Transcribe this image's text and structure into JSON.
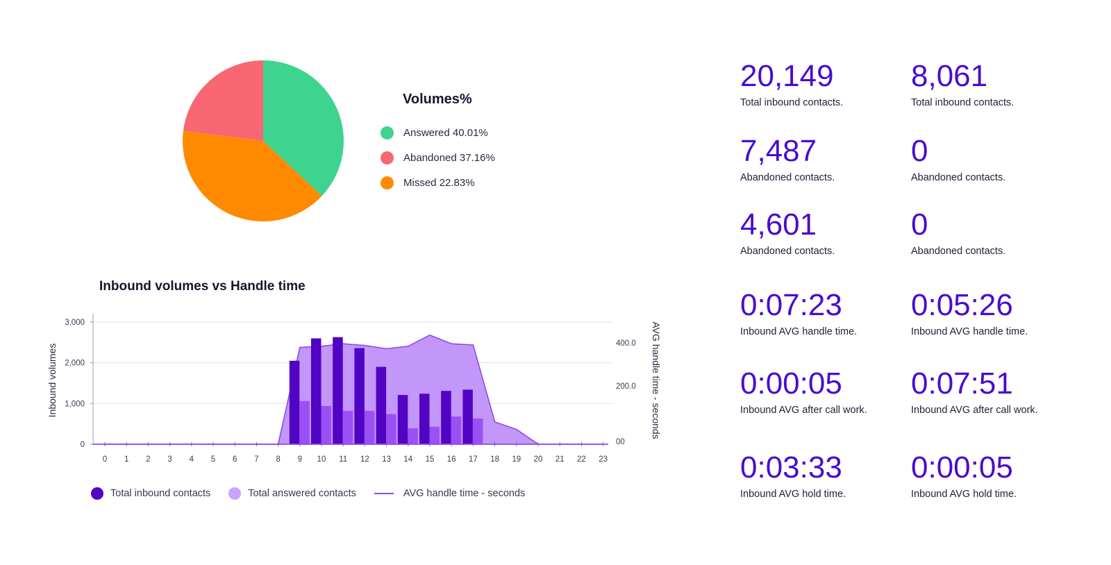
{
  "chart_data": [
    {
      "type": "pie",
      "title": "Volumes%",
      "legend_position": "right",
      "slices": [
        {
          "label": "Answered",
          "legend_text": "Answered 40.01%",
          "value": 40.01,
          "color": "#3ed38f"
        },
        {
          "label": "Abandoned",
          "legend_text": "Abandoned 37.16%",
          "value": 37.16,
          "color": "#f76672"
        },
        {
          "label": "Missed",
          "legend_text": "Missed 22.83%",
          "value": 22.83,
          "color": "#ff8a00"
        }
      ],
      "drawn_slices_clockwise_from_top": [
        {
          "label": "Answered",
          "value": 37.0,
          "color": "#3ed38f"
        },
        {
          "label": "Missed",
          "value": 40.0,
          "color": "#ff8a00"
        },
        {
          "label": "Abandoned",
          "value": 23.0,
          "color": "#f76672"
        }
      ]
    },
    {
      "type": "bar",
      "title": "Inbound volumes vs Handle time",
      "xlabel": "",
      "ylabel": "Inbound volumes",
      "y2label": "AVG handle time - seconds",
      "categories": [
        "0",
        "1",
        "2",
        "3",
        "4",
        "5",
        "6",
        "7",
        "8",
        "9",
        "10",
        "11",
        "12",
        "13",
        "14",
        "15",
        "16",
        "17",
        "18",
        "19",
        "20",
        "21",
        "22",
        "23"
      ],
      "ylim": [
        0,
        3000
      ],
      "yticks": [
        "0",
        "1,000",
        "2,000",
        "3,000"
      ],
      "ytick_values": [
        0,
        1000,
        2000,
        3000
      ],
      "y2lim": [
        0,
        850
      ],
      "y2ticks": [
        "00",
        "200.0",
        "400.0"
      ],
      "y2tick_values": [
        0,
        200,
        400
      ],
      "grid": true,
      "legend_position": "bottom-left",
      "series": [
        {
          "name": "Total inbound contacts",
          "kind": "bar",
          "axis": "left",
          "color": "#5204c4",
          "values": [
            0,
            0,
            0,
            0,
            0,
            0,
            0,
            0,
            0,
            2050,
            2600,
            2630,
            2360,
            1900,
            1210,
            1240,
            1310,
            1340,
            0,
            0,
            0,
            0,
            0,
            0
          ]
        },
        {
          "name": "Total answered contacts",
          "kind": "bar",
          "axis": "left",
          "color": "#9b50f5",
          "values": [
            0,
            0,
            0,
            0,
            0,
            0,
            0,
            0,
            0,
            1060,
            940,
            820,
            820,
            740,
            390,
            430,
            680,
            630,
            0,
            0,
            0,
            0,
            0,
            0
          ]
        },
        {
          "name": "AVG handle time - seconds",
          "kind": "area",
          "axis": "right",
          "color": "#8a4ce6",
          "fill": "#c396fa",
          "values": [
            0,
            0,
            0,
            0,
            0,
            0,
            0,
            0,
            0,
            390,
            395,
            405,
            398,
            385,
            395,
            440,
            405,
            400,
            90,
            60,
            0,
            0,
            0,
            0
          ]
        }
      ]
    }
  ],
  "pie": {
    "legend_title": "Volumes%",
    "items": [
      {
        "label": "Answered 40.01%",
        "color": "#3ed38f"
      },
      {
        "label": "Abandoned 37.16%",
        "color": "#f76672"
      },
      {
        "label": "Missed 22.83%",
        "color": "#ff8a00"
      }
    ]
  },
  "bar_chart": {
    "title": "Inbound volumes vs Handle time",
    "legend": [
      {
        "label": "Total inbound contacts",
        "color": "#5204c4",
        "shape": "dot"
      },
      {
        "label": "Total answered contacts",
        "color": "#c9a4fb",
        "shape": "dot"
      },
      {
        "label": "AVG handle time - seconds",
        "color": "#8a4ce6",
        "shape": "line"
      }
    ]
  },
  "stats": [
    {
      "value": "20,149",
      "label": "Total inbound contacts."
    },
    {
      "value": "8,061",
      "label": "Total inbound contacts."
    },
    {
      "value": "7,487",
      "label": "Abandoned contacts."
    },
    {
      "value": "0",
      "label": "Abandoned contacts."
    },
    {
      "value": "4,601",
      "label": "Abandoned contacts."
    },
    {
      "value": "0",
      "label": "Abandoned contacts."
    },
    {
      "value": "0:07:23",
      "label": "Inbound AVG handle time."
    },
    {
      "value": "0:05:26",
      "label": "Inbound AVG handle time."
    },
    {
      "value": "0:00:05",
      "label": "Inbound AVG after call work."
    },
    {
      "value": "0:07:51",
      "label": "Inbound AVG after call work."
    },
    {
      "value": "0:03:33",
      "label": "Inbound AVG hold time."
    },
    {
      "value": "0:00:05",
      "label": "Inbound AVG hold time."
    }
  ]
}
